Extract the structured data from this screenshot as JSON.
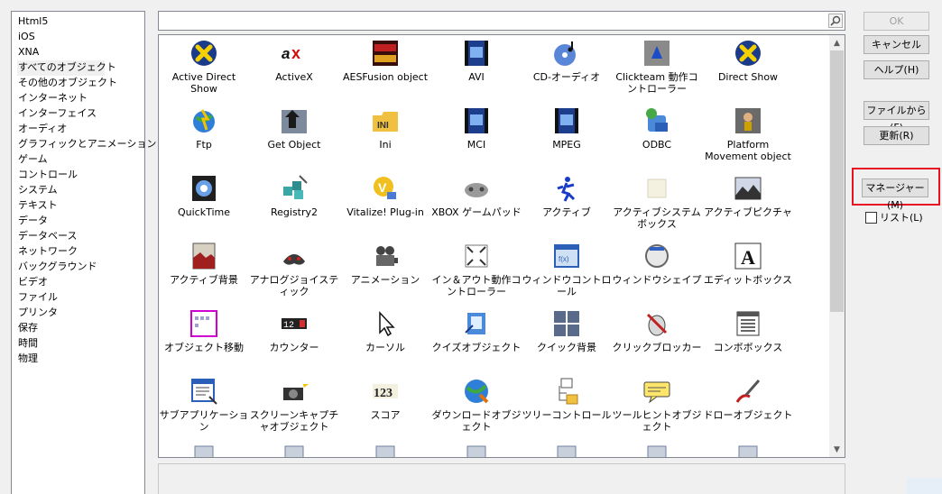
{
  "categories": [
    "Html5",
    "iOS",
    "XNA",
    "すべてのオブジェクト",
    "その他のオブジェクト",
    "インターネット",
    "インターフェイス",
    "オーディオ",
    "グラフィックとアニメーション",
    "ゲーム",
    "コントロール",
    "システム",
    "テキスト",
    "データ",
    "データベース",
    "ネットワーク",
    "バックグラウンド",
    "ビデオ",
    "ファイル",
    "プリンタ",
    "保存",
    "時間",
    "物理"
  ],
  "selected_category": "すべてのオブジェクト",
  "search": {
    "value": ""
  },
  "objects": [
    {
      "label": "Active Direct Show",
      "icon": "directx-x-icon"
    },
    {
      "label": "ActiveX",
      "icon": "activex-icon"
    },
    {
      "label": "AESFusion object",
      "icon": "aes-fusion-icon"
    },
    {
      "label": "AVI",
      "icon": "avi-film-icon"
    },
    {
      "label": "CD-オーディオ",
      "icon": "cd-audio-icon"
    },
    {
      "label": "Clickteam 動作コントローラー",
      "icon": "clickteam-movement-icon"
    },
    {
      "label": "Direct Show",
      "icon": "directx-x-icon"
    },
    {
      "label": "Ftp",
      "icon": "ftp-globe-icon"
    },
    {
      "label": "Get Object",
      "icon": "get-object-arrow-icon"
    },
    {
      "label": "Ini",
      "icon": "ini-folder-icon"
    },
    {
      "label": "MCI",
      "icon": "mci-film-icon"
    },
    {
      "label": "MPEG",
      "icon": "mpeg-film-icon"
    },
    {
      "label": "ODBC",
      "icon": "odbc-database-icon"
    },
    {
      "label": "Platform Movement object",
      "icon": "platform-movement-icon"
    },
    {
      "label": "QuickTime",
      "icon": "quicktime-icon"
    },
    {
      "label": "Registry2",
      "icon": "registry-cubes-icon"
    },
    {
      "label": "Vitalize! Plug-in",
      "icon": "vitalize-plugin-icon"
    },
    {
      "label": "XBOX ゲームパッド",
      "icon": "xbox-gamepad-icon"
    },
    {
      "label": "アクティブ",
      "icon": "active-runner-icon"
    },
    {
      "label": "アクティブシステムボックス",
      "icon": "active-system-box-icon"
    },
    {
      "label": "アクティブピクチャ",
      "icon": "active-picture-icon"
    },
    {
      "label": "アクティブ背景",
      "icon": "active-background-icon"
    },
    {
      "label": "アナログジョイスティック",
      "icon": "analog-joystick-icon"
    },
    {
      "label": "アニメーション",
      "icon": "animation-camera-icon"
    },
    {
      "label": "イン＆アウト動作コントローラー",
      "icon": "in-out-movement-icon"
    },
    {
      "label": "ウィンドウコントロール",
      "icon": "window-control-icon"
    },
    {
      "label": "ウィンドウシェイプ",
      "icon": "window-shape-icon"
    },
    {
      "label": "エディットボックス",
      "icon": "edit-box-icon"
    },
    {
      "label": "オブジェクト移動",
      "icon": "object-mover-icon"
    },
    {
      "label": "カウンター",
      "icon": "counter-icon"
    },
    {
      "label": "カーソル",
      "icon": "cursor-icon"
    },
    {
      "label": "クイズオブジェクト",
      "icon": "quiz-object-icon"
    },
    {
      "label": "クイック背景",
      "icon": "quick-backdrop-icon"
    },
    {
      "label": "クリックブロッカー",
      "icon": "click-blocker-icon"
    },
    {
      "label": "コンボボックス",
      "icon": "combo-box-icon"
    },
    {
      "label": "サブアプリケーション",
      "icon": "sub-application-icon"
    },
    {
      "label": "スクリーンキャプチャオブジェクト",
      "icon": "screen-capture-icon"
    },
    {
      "label": "スコア",
      "icon": "score-icon"
    },
    {
      "label": "ダウンロードオブジェクト",
      "icon": "download-globe-icon"
    },
    {
      "label": "ツリーコントロール",
      "icon": "tree-control-icon"
    },
    {
      "label": "ツールヒントオブジェクト",
      "icon": "tooltip-icon"
    },
    {
      "label": "ドローオブジェクト",
      "icon": "draw-object-icon"
    }
  ],
  "buttons": {
    "ok": "OK",
    "cancel": "キャンセル",
    "help": "ヘルプ(H)",
    "from_file": "ファイルから(F)",
    "refresh": "更新(R)",
    "manager": "マネージャー(M)"
  },
  "list_checkbox": {
    "label": "リスト(L)",
    "checked": false
  },
  "colors": {
    "highlight": "#e81123"
  }
}
